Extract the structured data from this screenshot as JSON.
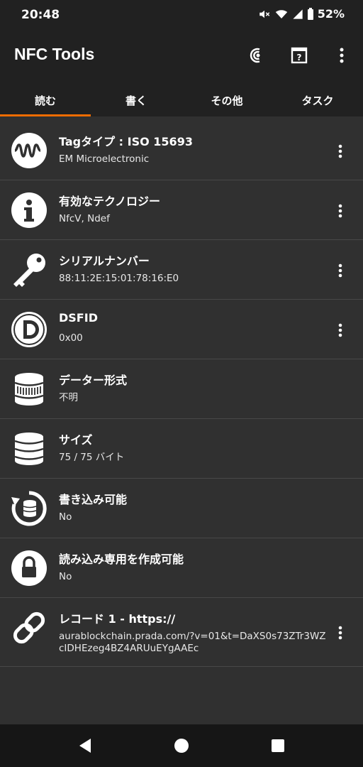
{
  "status": {
    "time": "20:48",
    "battery": "52%"
  },
  "app": {
    "title": "NFC Tools"
  },
  "tabs": [
    {
      "label": "読む",
      "active": true
    },
    {
      "label": "書く",
      "active": false
    },
    {
      "label": "その他",
      "active": false
    },
    {
      "label": "タスク",
      "active": false
    }
  ],
  "rows": [
    {
      "title": "Tagタイプ : ISO 15693",
      "value": "EM Microelectronic",
      "icon": "wave-icon"
    },
    {
      "title": "有効なテクノロジー",
      "value": "NfcV, Ndef",
      "icon": "info-icon"
    },
    {
      "title": "シリアルナンバー",
      "value": "88:11:2E:15:01:78:16:E0",
      "icon": "key-icon"
    },
    {
      "title": "DSFID",
      "value": "0x00",
      "icon": "d-letter-icon"
    },
    {
      "title": "データー形式",
      "value": "不明",
      "icon": "database-icon"
    },
    {
      "title": "サイズ",
      "value": "75 / 75 バイト",
      "icon": "database-stack-icon"
    },
    {
      "title": "書き込み可能",
      "value": "No",
      "icon": "rewrite-database-icon"
    },
    {
      "title": "読み込み専用を作成可能",
      "value": "No",
      "icon": "lock-icon"
    },
    {
      "title": "レコード 1 - https://",
      "value": "aurablockchain.prada.com/?v=01&t=DaXS0s73ZTr3WZcIDHEzeg4BZ4ARUuEYgAAEc",
      "icon": "link-icon"
    }
  ],
  "colors": {
    "accent": "#ef6c00",
    "toolbar": "#212121",
    "background": "#303030"
  }
}
